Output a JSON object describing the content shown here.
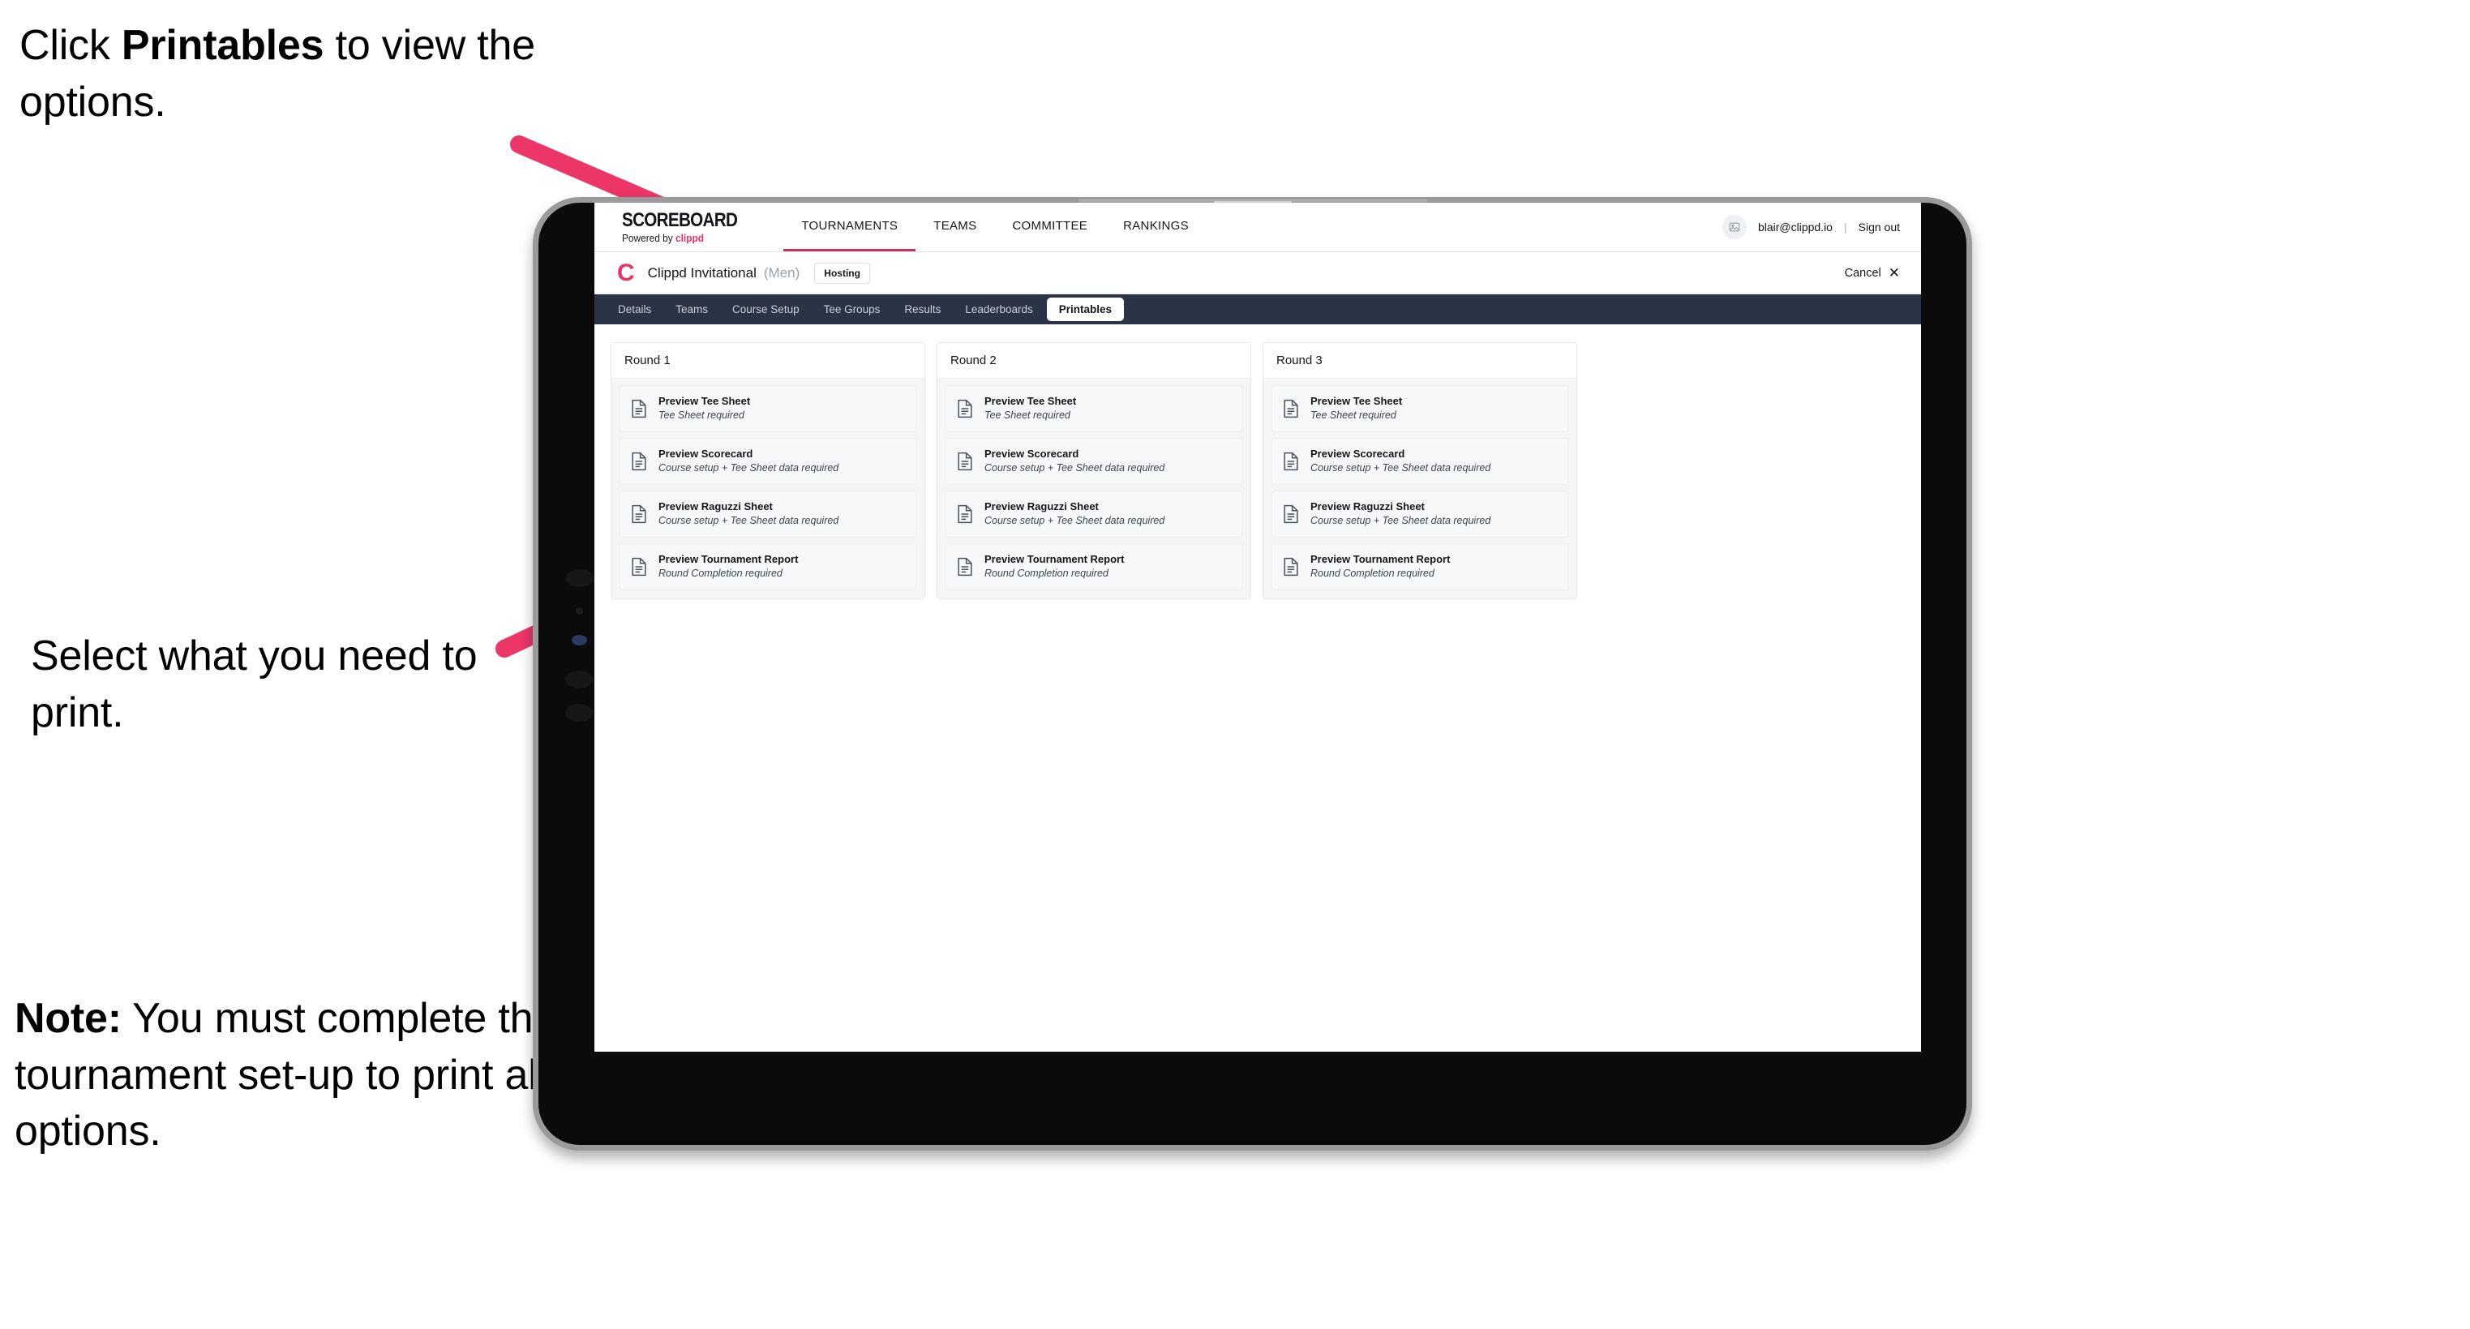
{
  "annotations": {
    "top": {
      "prefix": "Click ",
      "bold": "Printables",
      "suffix": " to view the options."
    },
    "middle": {
      "text": "Select what you need to print."
    },
    "note": {
      "bold": "Note:",
      "text": " You must complete the tournament set-up to print all the options."
    }
  },
  "colors": {
    "accent_pink": "#e8336a",
    "arrow_pink": "#ec3668",
    "navbar_navy": "#2b3447",
    "tab_active_bg": "#ffffff",
    "brand_underline": "#c2345a"
  },
  "app": {
    "brand": {
      "title": "SCOREBOARD",
      "powered_by": "Powered by ",
      "powered_brand": "clippd"
    },
    "nav": [
      {
        "label": "TOURNAMENTS",
        "active": true
      },
      {
        "label": "TEAMS",
        "active": false
      },
      {
        "label": "COMMITTEE",
        "active": false
      },
      {
        "label": "RANKINGS",
        "active": false
      }
    ],
    "header_right": {
      "avatar_icon": "user-avatar-icon",
      "email": "blair@clippd.io",
      "separator": "|",
      "sign_out": "Sign out"
    },
    "sub_header": {
      "logo_mark": "C",
      "tournament_name": "Clippd Invitational",
      "gender": "(Men)",
      "status_badge": "Hosting",
      "cancel_label": "Cancel",
      "cancel_icon": "✕"
    },
    "tabs": [
      {
        "label": "Details",
        "active": false
      },
      {
        "label": "Teams",
        "active": false
      },
      {
        "label": "Course Setup",
        "active": false
      },
      {
        "label": "Tee Groups",
        "active": false
      },
      {
        "label": "Results",
        "active": false
      },
      {
        "label": "Leaderboards",
        "active": false
      },
      {
        "label": "Printables",
        "active": true
      }
    ],
    "rounds": [
      {
        "title": "Round 1",
        "items": [
          {
            "title": "Preview Tee Sheet",
            "sub": "Tee Sheet required"
          },
          {
            "title": "Preview Scorecard",
            "sub": "Course setup + Tee Sheet data required"
          },
          {
            "title": "Preview Raguzzi Sheet",
            "sub": "Course setup + Tee Sheet data required"
          },
          {
            "title": "Preview Tournament Report",
            "sub": "Round Completion required"
          }
        ]
      },
      {
        "title": "Round 2",
        "items": [
          {
            "title": "Preview Tee Sheet",
            "sub": "Tee Sheet required"
          },
          {
            "title": "Preview Scorecard",
            "sub": "Course setup + Tee Sheet data required"
          },
          {
            "title": "Preview Raguzzi Sheet",
            "sub": "Course setup + Tee Sheet data required"
          },
          {
            "title": "Preview Tournament Report",
            "sub": "Round Completion required"
          }
        ]
      },
      {
        "title": "Round 3",
        "items": [
          {
            "title": "Preview Tee Sheet",
            "sub": "Tee Sheet required"
          },
          {
            "title": "Preview Scorecard",
            "sub": "Course setup + Tee Sheet data required"
          },
          {
            "title": "Preview Raguzzi Sheet",
            "sub": "Course setup + Tee Sheet data required"
          },
          {
            "title": "Preview Tournament Report",
            "sub": "Round Completion required"
          }
        ]
      }
    ]
  }
}
